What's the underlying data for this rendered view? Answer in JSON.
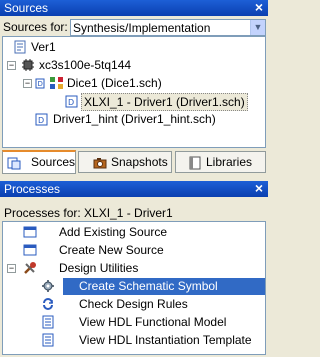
{
  "sources": {
    "title": "Sources",
    "close": "×",
    "sources_for_label": "Sources for:",
    "sources_for_value": "Synthesis/Implementation",
    "tree": [
      {
        "label": "Ver1"
      },
      {
        "label": "xc3s100e-5tq144"
      },
      {
        "label": "Dice1 (Dice1.sch)"
      },
      {
        "label": "XLXI_1 - Driver1 (Driver1.sch)"
      },
      {
        "label": "Driver1_hint (Driver1_hint.sch)"
      }
    ],
    "tabs": [
      {
        "label": "Sources"
      },
      {
        "label": "Snapshots"
      },
      {
        "label": "Libraries"
      }
    ]
  },
  "processes": {
    "title": "Processes",
    "close": "×",
    "processes_for": "Processes for: XLXI_1 - Driver1",
    "items": [
      {
        "label": "Add Existing Source"
      },
      {
        "label": "Create New Source"
      },
      {
        "label": "Design Utilities"
      },
      {
        "label": "Create Schematic Symbol"
      },
      {
        "label": "Check Design Rules"
      },
      {
        "label": "View HDL Functional Model"
      },
      {
        "label": "View HDL Instantiation Template"
      }
    ]
  },
  "icons": [
    "document-icon",
    "chip-icon",
    "schematic-icon",
    "gear-icon",
    "arrows-icon",
    "tools-icon"
  ],
  "colors": {
    "header_blue": "#0a3fb0",
    "selection_blue": "#316ac5",
    "tab_accent": "#e68b2c"
  }
}
